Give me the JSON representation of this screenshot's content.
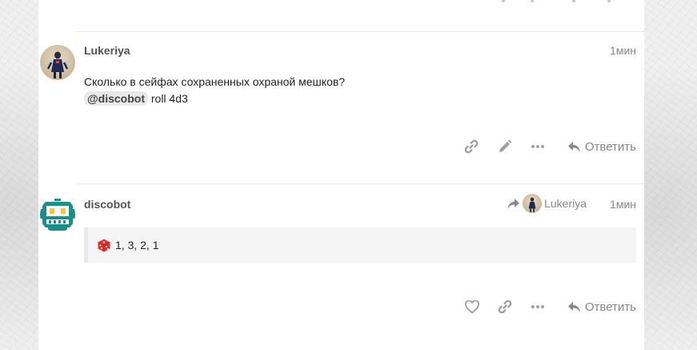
{
  "posts": [
    {
      "username": "Lukeriya",
      "time": "1мин",
      "line1": "Сколько в сейфах сохраненных охраной мешков?",
      "mention": "@discobot",
      "line2": "roll 4d3",
      "reply_label": "Ответить",
      "icons": [
        "link-icon",
        "pencil-icon",
        "more-icon",
        "reply-icon"
      ]
    },
    {
      "username": "discobot",
      "time": "1мин",
      "reply_to_name": "Lukeriya",
      "dice_result": "1, 3, 2, 1",
      "reply_label": "Ответить",
      "icons": [
        "heart-icon",
        "link-icon",
        "more-icon",
        "reply-icon",
        "dice-icon",
        "share-arrow-icon"
      ]
    }
  ],
  "colors": {
    "bot_avatar": "#1a8f8a",
    "dice": "#e0312e",
    "action_icons": "#999999"
  }
}
